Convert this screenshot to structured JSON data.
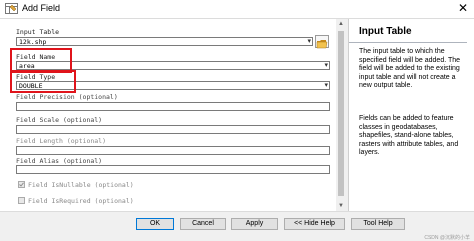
{
  "window": {
    "title": "Add Field",
    "close_glyph": "✕"
  },
  "form": {
    "input_table": {
      "label": "Input Table",
      "value": "12k.shp"
    },
    "field_name": {
      "label": "Field Name",
      "value": "area"
    },
    "field_type": {
      "label": "Field Type",
      "value": "DOUBLE"
    },
    "field_precision": {
      "label": "Field Precision (optional)",
      "value": ""
    },
    "field_scale": {
      "label": "Field Scale (optional)",
      "value": ""
    },
    "field_length": {
      "label": "Field Length (optional)",
      "value": ""
    },
    "field_alias": {
      "label": "Field Alias (optional)",
      "value": ""
    },
    "field_isnullable": {
      "label": "Field IsNullable (optional)",
      "checked": true
    },
    "field_isrequired": {
      "label": "Field IsRequired (optional)",
      "checked": false
    }
  },
  "help": {
    "title": "Input Table",
    "paragraph1": "The input table to which the specified field will be added. The field will be added to the existing input table and will not create a new output table.",
    "paragraph2": "Fields can be added to feature classes in geodatabases, shapefiles, stand-alone tables, rasters with attribute tables, and layers."
  },
  "buttons": {
    "ok": "OK",
    "cancel": "Cancel",
    "apply": "Apply",
    "hide_help": "<< Hide Help",
    "tool_help": "Tool Help"
  },
  "watermark": "CSDN @沉默的小羊",
  "colors": {
    "highlight": "#e0141b",
    "accent": "#0078d7"
  }
}
